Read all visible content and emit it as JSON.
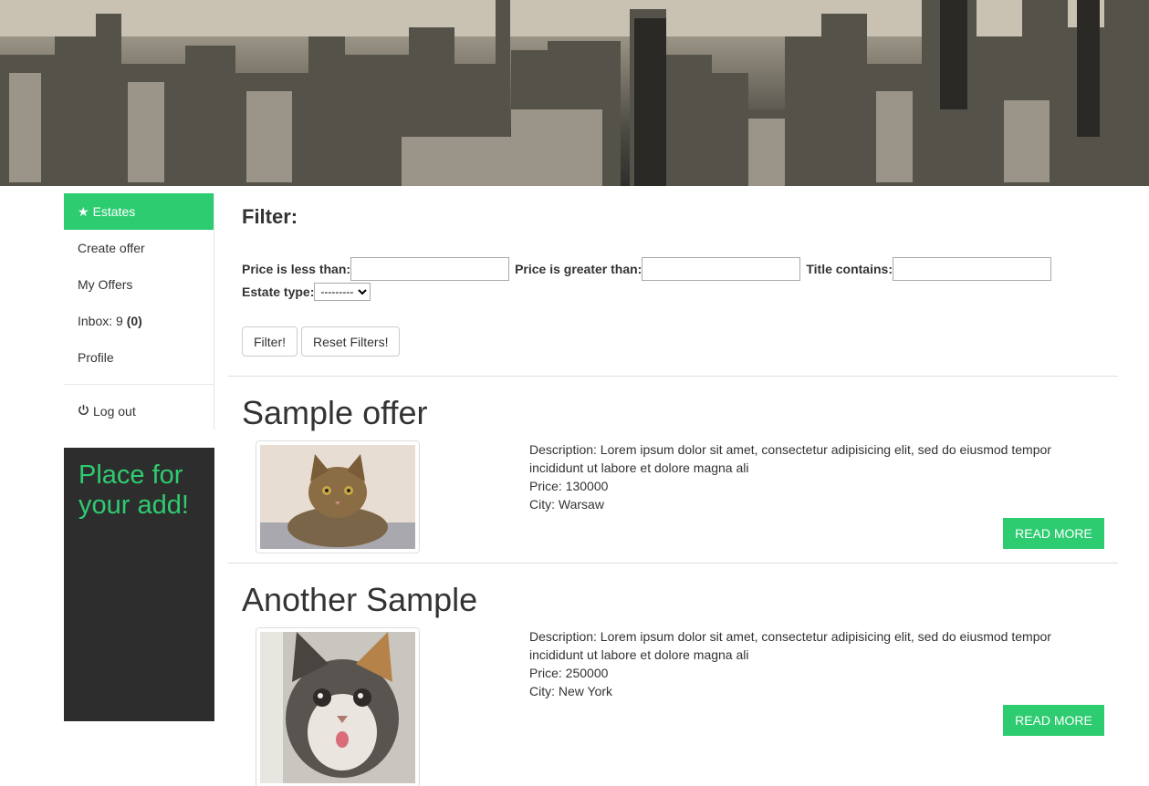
{
  "nav": {
    "items": [
      {
        "label": "Estates",
        "icon": "star-icon",
        "active": true
      },
      {
        "label": "Create offer"
      },
      {
        "label": "My Offers"
      },
      {
        "label": "Profile"
      }
    ],
    "inbox": {
      "label": "Inbox: 9",
      "count": "(0)"
    },
    "logout": {
      "label": "Log out",
      "icon": "power-icon"
    }
  },
  "ad": {
    "text": "Place for your add!"
  },
  "filter": {
    "title": "Filter:",
    "price_less_label": "Price is less than:",
    "price_less_value": "",
    "price_greater_label": "Price is greater than:",
    "price_greater_value": "",
    "title_contains_label": "Title contains:",
    "title_contains_value": "",
    "estate_type_label": "Estate type:",
    "estate_type_selected": "---------",
    "filter_button": "Filter!",
    "reset_button": "Reset Filters!"
  },
  "offers": [
    {
      "title": "Sample offer",
      "description": "Description: Lorem ipsum dolor sit amet, consectetur adipisicing elit, sed do eiusmod tempor incididunt ut labore et dolore magna ali",
      "price": "Price: 130000",
      "city": "City: Warsaw",
      "read_more": "READ MORE"
    },
    {
      "title": "Another Sample",
      "description": "Description: Lorem ipsum dolor sit amet, consectetur adipisicing elit, sed do eiusmod tempor incididunt ut labore et dolore magna ali",
      "price": "Price: 250000",
      "city": "City: New York",
      "read_more": "READ MORE"
    }
  ],
  "colors": {
    "accent": "#2ecc71",
    "ad_background": "#2d2d2d"
  }
}
